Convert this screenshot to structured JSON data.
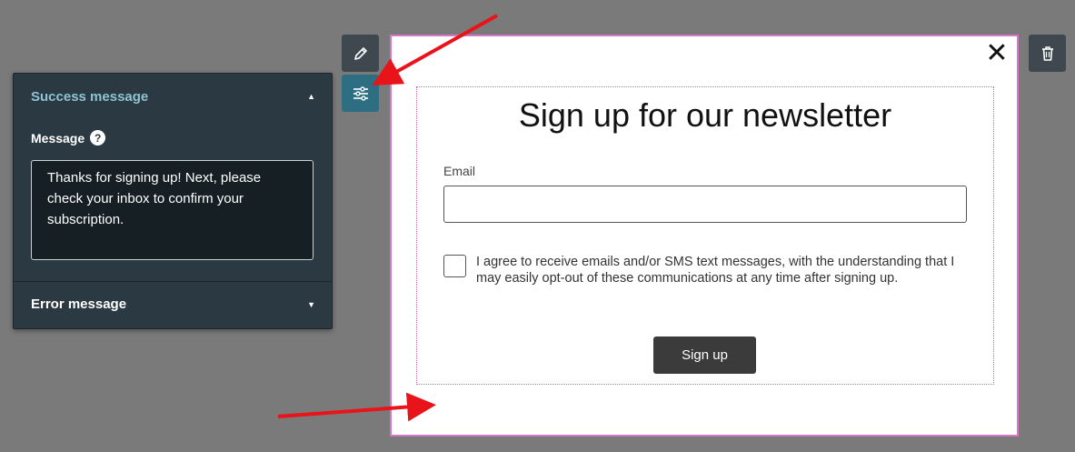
{
  "panel": {
    "success_title": "Success message",
    "message_label": "Message",
    "help_symbol": "?",
    "message_value": "Thanks for signing up! Next, please check your inbox to confirm your subscription.",
    "error_title": "Error message",
    "caret_up": "▲",
    "caret_down": "▼"
  },
  "tools": {
    "edit_icon": "pencil-icon",
    "settings_icon": "sliders-icon",
    "trash_icon": "trash-icon"
  },
  "popup": {
    "close_symbol": "✕",
    "title": "Sign up for our newsletter",
    "email_label": "Email",
    "email_value": "",
    "consent_text": "I agree to receive emails and/or SMS text messages, with the understanding that I may easily opt-out of these communications at any time after signing up.",
    "signup_label": "Sign up"
  },
  "colors": {
    "annotation_arrow": "#e8141a",
    "panel_bg": "#2b3a42",
    "accent": "#8fc3d4",
    "popup_border": "#d577c9"
  }
}
